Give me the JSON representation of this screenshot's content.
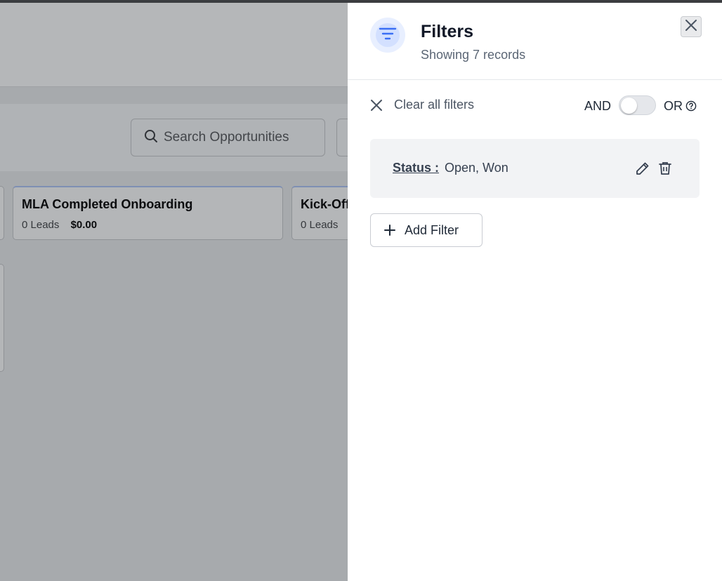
{
  "background": {
    "search": {
      "placeholder": "Search Opportunities"
    },
    "stages": [
      {
        "name": "MLA Completed Onboarding",
        "leads": "0 Leads",
        "amount": "$0.00"
      },
      {
        "name": "Kick-Off",
        "leads": "0 Leads",
        "amount": ""
      }
    ]
  },
  "panel": {
    "title": "Filters",
    "subtitle": "Showing 7 records",
    "clear_all_label": "Clear all filters",
    "and_label": "AND",
    "or_label": "OR",
    "toggle_state": "AND",
    "filters": [
      {
        "field": "Status :",
        "values": "Open, Won"
      }
    ],
    "add_filter_label": "Add Filter"
  },
  "colors": {
    "accent": "#3b6ff5",
    "overlay": "#a7aaad"
  },
  "icons": [
    "filter-icon",
    "close-icon",
    "help-icon",
    "edit-icon",
    "trash-icon",
    "plus-icon",
    "search-icon"
  ]
}
